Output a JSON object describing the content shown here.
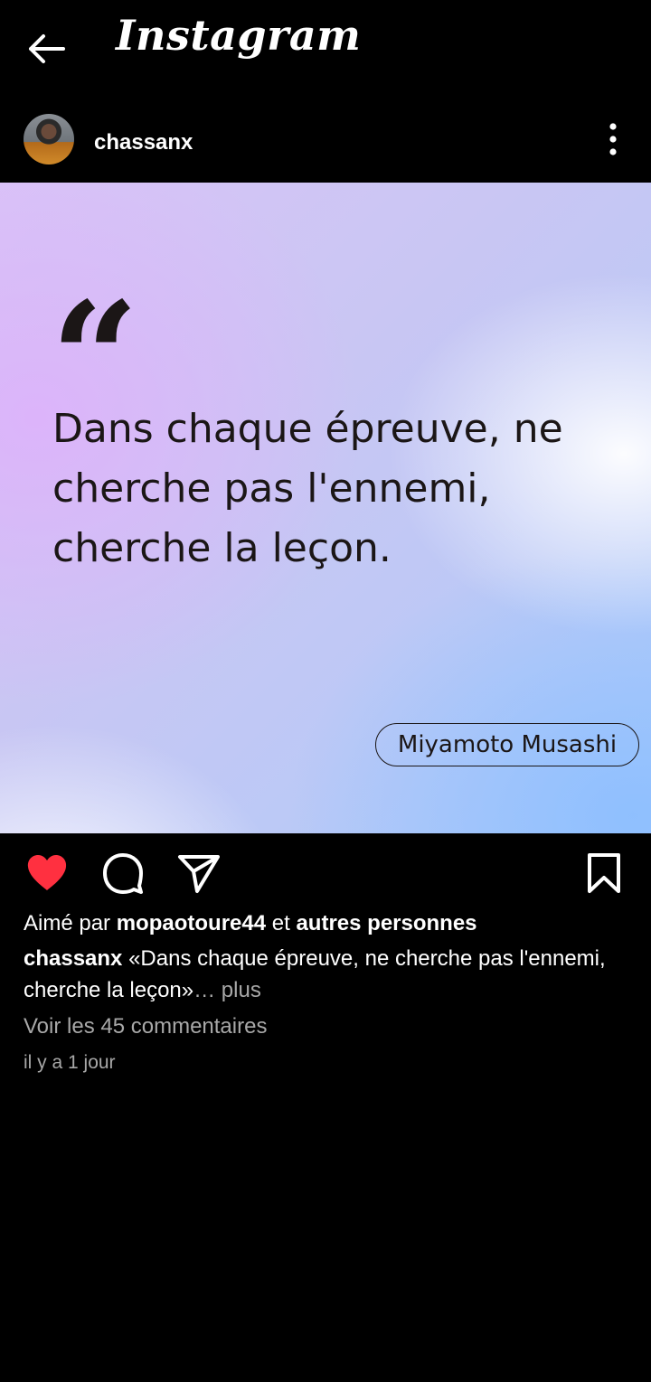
{
  "app": {
    "title": "Instagram"
  },
  "icons": {
    "back": "arrow-left-icon",
    "more": "vertical-dots-icon",
    "like": "heart-filled-icon",
    "comment": "comment-bubble-icon",
    "share": "paper-plane-icon",
    "save": "bookmark-icon"
  },
  "colors": {
    "background": "#000000",
    "like_active": "#ff3040",
    "text_primary": "#ffffff",
    "text_secondary": "#a8a8a8"
  },
  "post": {
    "username": "chassanx",
    "image": {
      "quote_mark": "“",
      "quote_text": "Dans chaque épreuve, ne cherche pas l'ennemi, cherche la leçon.",
      "author": "Miyamoto Musashi"
    },
    "liked": true,
    "likes": {
      "prefix": "Aimé par",
      "user": "mopaotoure44",
      "connector": "et",
      "others": "autres personnes"
    },
    "caption": {
      "username": "chassanx",
      "text": "«Dans chaque épreuve, ne cherche pas l'ennemi, cherche la leçon»",
      "truncation": "…",
      "more_label": "plus"
    },
    "comments_link": "Voir les 45 commentaires",
    "time_ago": "il y a 1 jour"
  }
}
